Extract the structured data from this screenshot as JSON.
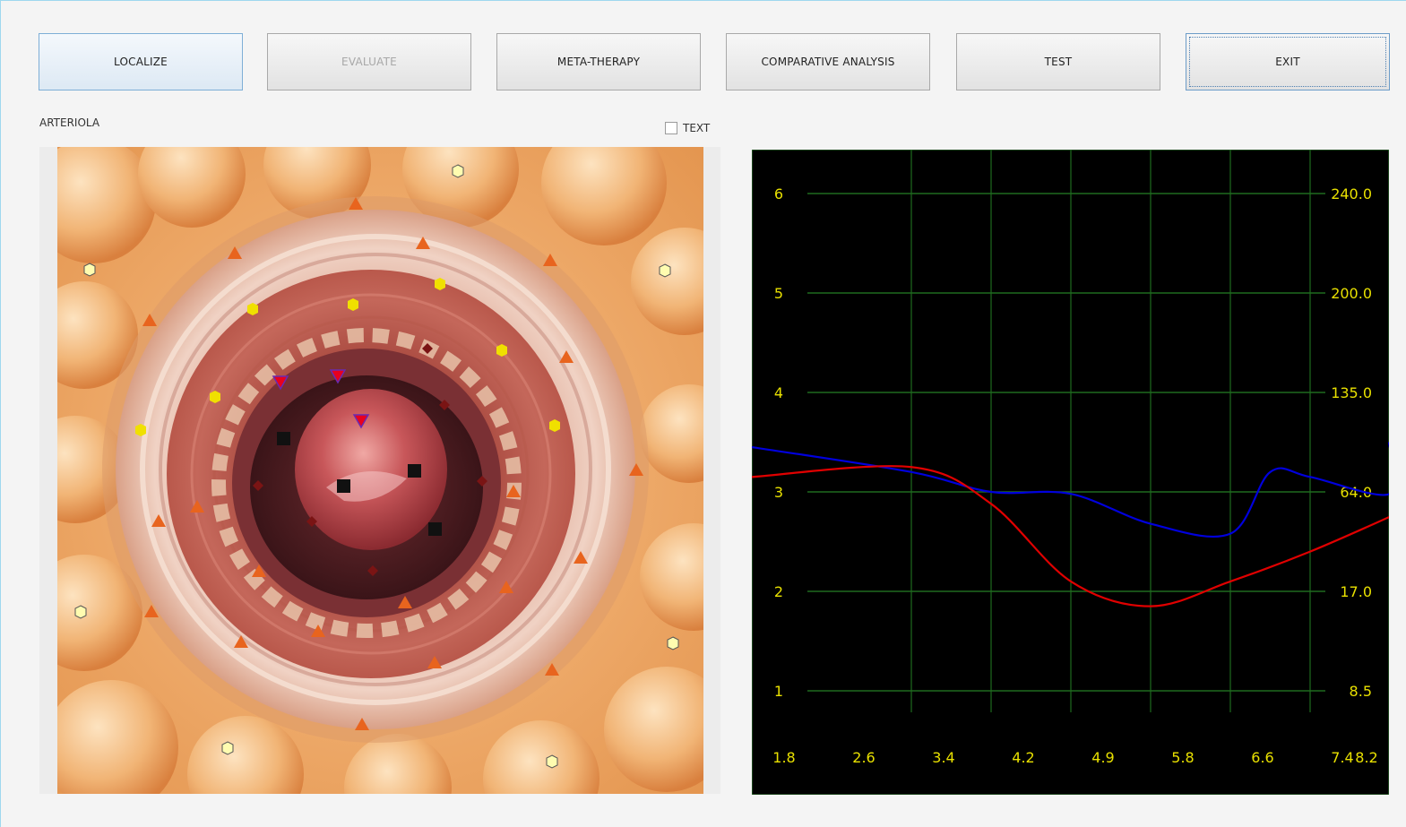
{
  "toolbar": {
    "buttons": [
      {
        "id": "localize",
        "label": "LOCALIZE",
        "state": "active"
      },
      {
        "id": "evaluate",
        "label": "EVALUATE",
        "state": "disabled"
      },
      {
        "id": "meta-therapy",
        "label": "META-THERAPY",
        "state": "normal"
      },
      {
        "id": "comparative-analysis",
        "label": "COMPARATIVE ANALYSIS",
        "state": "normal"
      },
      {
        "id": "test",
        "label": "TEST",
        "state": "normal"
      },
      {
        "id": "exit",
        "label": "EXIT",
        "state": "focused"
      }
    ]
  },
  "section_label": "ARTERIOLA",
  "text_toggle": {
    "label": "TEXT",
    "checked": false
  },
  "chart_data": {
    "type": "line",
    "background": "#000000",
    "grid": true,
    "grid_color": "#1f6b1f",
    "tick_color": "#e8e000",
    "left_ticks": [
      "6",
      "5",
      "4",
      "3",
      "2",
      "1"
    ],
    "right_ticks": [
      "240.0",
      "200.0",
      "135.0",
      "64.0",
      "17.0",
      "8.5"
    ],
    "x_ticks": [
      "1.8",
      "2.6",
      "3.4",
      "4.2",
      "4.9",
      "5.8",
      "6.6",
      "7.4",
      "8.2"
    ],
    "ylim": [
      0.5,
      6.5
    ],
    "series": [
      {
        "color": "#0000dd",
        "points": [
          [
            1.8,
            3.45
          ],
          [
            2.6,
            3.2
          ],
          [
            3.4,
            3.0
          ],
          [
            4.2,
            2.98
          ],
          [
            4.9,
            2.68
          ],
          [
            5.8,
            2.58
          ],
          [
            6.2,
            3.2
          ],
          [
            6.6,
            3.15
          ],
          [
            7.4,
            2.98
          ],
          [
            8.2,
            3.5
          ]
        ]
      },
      {
        "color": "#e00000",
        "points": [
          [
            1.8,
            3.15
          ],
          [
            2.6,
            3.25
          ],
          [
            3.4,
            2.88
          ],
          [
            4.2,
            2.1
          ],
          [
            4.9,
            1.85
          ],
          [
            5.8,
            2.1
          ],
          [
            6.6,
            2.4
          ],
          [
            7.4,
            2.75
          ],
          [
            8.2,
            2.75
          ]
        ]
      }
    ]
  }
}
